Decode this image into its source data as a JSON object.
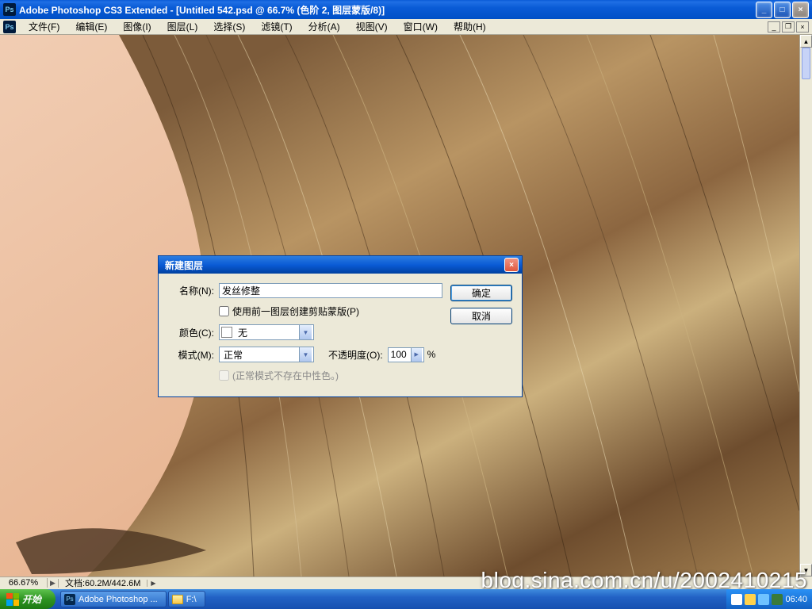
{
  "titlebar": {
    "ps_badge": "Ps",
    "title": "Adobe Photoshop CS3 Extended - [Untitled 542.psd @ 66.7% (色阶 2, 图层蒙版/8)]"
  },
  "menubar": {
    "items": [
      "文件(F)",
      "编辑(E)",
      "图像(I)",
      "图层(L)",
      "选择(S)",
      "滤镜(T)",
      "分析(A)",
      "视图(V)",
      "窗口(W)",
      "帮助(H)"
    ]
  },
  "statusbar": {
    "zoom": "66.67%",
    "docinfo": "文档:60.2M/442.6M"
  },
  "dialog": {
    "title": "新建图层",
    "labels": {
      "name": "名称(N):",
      "color": "颜色(C):",
      "mode": "模式(M):",
      "opacity": "不透明度(O):"
    },
    "values": {
      "name": "发丝修整",
      "clip_prev": "使用前一图层创建剪贴蒙版(P)",
      "color": "无",
      "mode": "正常",
      "opacity": "100",
      "opacity_unit": "%",
      "neutral_note": "(正常模式不存在中性色。)"
    },
    "buttons": {
      "ok": "确定",
      "cancel": "取消"
    }
  },
  "taskbar": {
    "start": "开始",
    "items": [
      {
        "icon": "ps",
        "label": "Adobe Photoshop ..."
      },
      {
        "icon": "folder",
        "label": "F:\\"
      }
    ],
    "clock": "06:40"
  },
  "watermark": "blog.sina.com.cn/u/2002410215"
}
